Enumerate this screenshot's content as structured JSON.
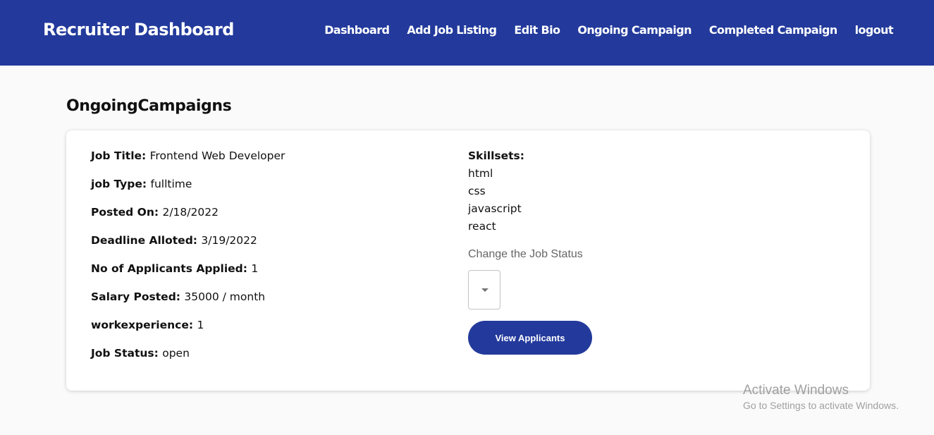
{
  "header": {
    "brand": "Recruiter Dashboard",
    "nav": [
      "Dashboard",
      "Add Job Listing",
      "Edit Bio",
      "Ongoing Campaign",
      "Completed Campaign",
      "logout"
    ]
  },
  "page_title": "OngoingCampaigns",
  "campaign": {
    "fields": [
      {
        "label": "Job Title:",
        "value": "Frontend Web Developer"
      },
      {
        "label": "job Type:",
        "value": "fulltime"
      },
      {
        "label": "Posted On:",
        "value": "2/18/2022"
      },
      {
        "label": "Deadline Alloted:",
        "value": "3/19/2022"
      },
      {
        "label": "No of Applicants Applied:",
        "value": "1"
      },
      {
        "label": "Salary Posted:",
        "value": "35000 / month"
      },
      {
        "label": "workexperience:",
        "value": "1"
      },
      {
        "label": "Job Status:",
        "value": "open"
      }
    ],
    "skillsets_label": "Skillsets:",
    "skills": [
      "html",
      "css",
      "javascript",
      "react"
    ],
    "status_select_label": "Change the Job Status",
    "status_select_value": "",
    "view_button": "View Applicants"
  },
  "watermark": {
    "title": "Activate Windows",
    "subtitle": "Go to Settings to activate Windows."
  },
  "colors": {
    "primary": "#233a9c",
    "background": "#fafafa",
    "card": "#ffffff"
  }
}
